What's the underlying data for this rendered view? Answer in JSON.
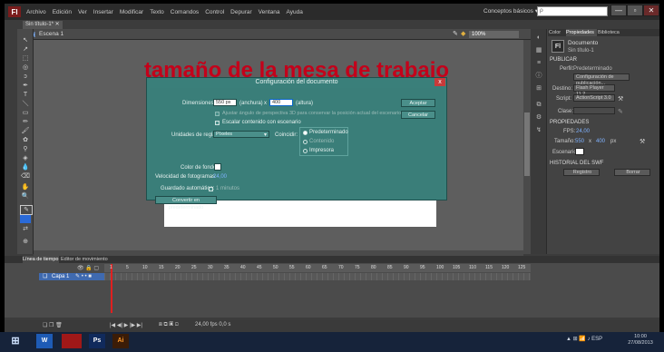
{
  "app": {
    "logo": "Fl"
  },
  "menu": {
    "items": [
      "Archivo",
      "Edición",
      "Ver",
      "Insertar",
      "Modificar",
      "Texto",
      "Comandos",
      "Control",
      "Depurar",
      "Ventana",
      "Ayuda"
    ]
  },
  "workspace": {
    "label": "Conceptos básicos ▾",
    "search_placeholder": "ρ"
  },
  "window_controls": {
    "min": "—",
    "max": "▫",
    "close": "✕"
  },
  "document": {
    "tab": "Sin título-1* ✕",
    "scene": "Escena 1",
    "zoom": "100%"
  },
  "overlay": {
    "text": "tamaño de la mesa de trabajo"
  },
  "dialog": {
    "title": "Configuración del documento",
    "close": "x",
    "dimensions_label": "Dimensiones:",
    "width_value": "550 px",
    "width_unit": "(anchura)",
    "x_sep": "x",
    "height_value": "400",
    "height_unit": "(altura)",
    "adjust_3d": "Ajustar ángulo de perspectiva 3D para conservar la posición actual del escenario",
    "scale_content": "Escalar contenido con escenario",
    "ruler_units_label": "Unidades de regla:",
    "ruler_units_value": "Píxeles",
    "match_label": "Coincidir:",
    "match_options": [
      "Predeterminado",
      "Contenido",
      "Impresora"
    ],
    "bg_color_label": "Color de fondo:",
    "fps_label": "Velocidad de fotogramas:",
    "fps_value": "24,00",
    "auto_save_label": "Guardado automático:",
    "auto_save_value": "1 minutos",
    "make_default": "Convertir en predeterminado",
    "ok": "Aceptar",
    "cancel": "Cancelar"
  },
  "panel": {
    "tabs": [
      "Color",
      "Propiedades",
      "Biblioteca"
    ],
    "doc_title": "Documento",
    "doc_icon": "Fl",
    "doc_name": "Sin título-1",
    "publish_header": "PUBLICAR",
    "profile_label": "Perfil:",
    "profile_value": "Predeterminado",
    "publish_settings": "Configuración de publicación...",
    "target_label": "Destino:",
    "target_value": "Flash Player 11.2",
    "script_label": "Script:",
    "script_value": "ActionScript 3.0",
    "class_label": "Clase:",
    "properties_header": "PROPIEDADES",
    "fps_label": "FPS:",
    "fps_value": "24,00",
    "size_label": "Tamaño:",
    "size_w": "550",
    "size_x": "x",
    "size_h": "400",
    "size_unit": "px",
    "stage_label": "Escenario:",
    "swf_header": "HISTORIAL DEL SWF",
    "log_btn": "Registro",
    "clear_btn": "Borrar"
  },
  "timeline": {
    "tabs": [
      "Línea de tiempo",
      "Editor de movimiento"
    ],
    "layer_name": "Capa 1",
    "ticks": [
      "1",
      "5",
      "10",
      "15",
      "20",
      "25",
      "30",
      "35",
      "40",
      "45",
      "50",
      "55",
      "60",
      "65",
      "70",
      "75",
      "80",
      "85",
      "90",
      "95",
      "100",
      "105",
      "110",
      "115",
      "120",
      "125"
    ],
    "footer": "24,00 fps  0,0 s"
  },
  "taskbar": {
    "apps": [
      "W",
      "",
      "Ps",
      "Ai"
    ],
    "tray": "▲ ⊞ 📶 ♪ ESP",
    "time": "10:00",
    "date": "27/08/2013"
  },
  "colors": {
    "overlay_red": "#c4001a",
    "dialog_teal": "#3a7f7a",
    "taskbar": "#16233a"
  }
}
